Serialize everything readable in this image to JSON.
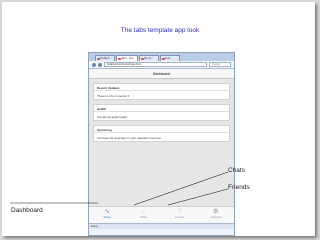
{
  "slide": {
    "title": "The tabs template app look",
    "annotations": {
      "chats": "Chats",
      "friends": "Friends",
      "dashboard": "Dashboard"
    }
  },
  "browser": {
    "tabs": [
      "Mozilla F...",
      "http://...html",
      "Run of...",
      "Ionic..."
    ],
    "url": "localhost/ionic/www/index.html",
    "search_placeholder": "Google",
    "status": "Ready"
  },
  "app": {
    "header": "Dashboard",
    "cards": [
      {
        "title": "Recent Updates",
        "body": "There is a fire in sector 3"
      },
      {
        "title": "Health",
        "body": "You ate an apple today!"
      },
      {
        "title": "Upcoming",
        "body": "You have 29 meetings on your calendar tomorrow."
      }
    ],
    "tabs": [
      {
        "label": "Status",
        "icon": "pulse-icon",
        "glyph": "∿"
      },
      {
        "label": "Chats",
        "icon": "chat-icon",
        "glyph": "◌"
      },
      {
        "label": "Friends",
        "icon": "heart-icon",
        "glyph": "♡"
      },
      {
        "label": "Account",
        "icon": "gear-icon",
        "glyph": "⚙"
      }
    ],
    "active_tab": "Status"
  },
  "colors": {
    "title": "#2a2ab8",
    "tab_active": "#3a7bd5",
    "tab_inactive": "#888888"
  }
}
